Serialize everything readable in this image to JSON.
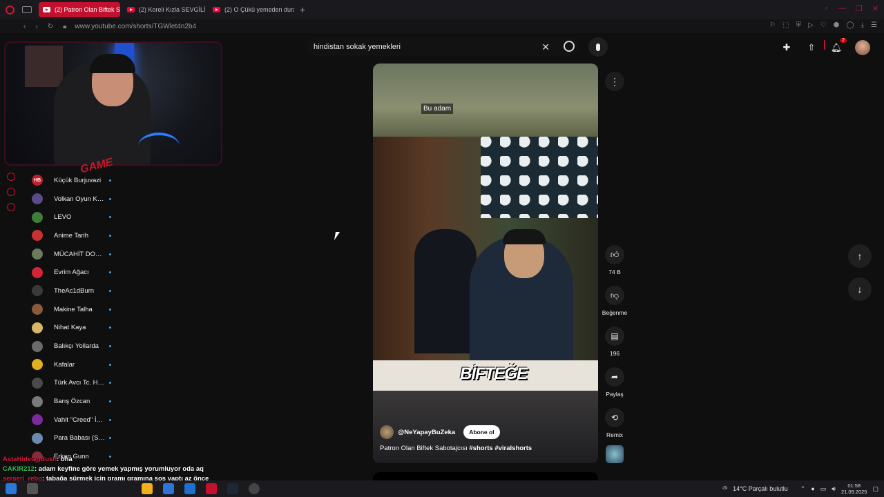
{
  "browser": {
    "tabs": [
      {
        "label": "(2) Patron Olan Biftek Sab",
        "active": true
      },
      {
        "label": "(2) Koreli Kızla SEVGİLİ O",
        "active": false
      },
      {
        "label": "(2) O Çükü yemeden dura",
        "active": false
      }
    ],
    "url": "www.youtube.com/shorts/TGWlet4n2b4",
    "accent": "#c4102f"
  },
  "search": {
    "query": "hindistan sokak yemekleri"
  },
  "header": {
    "notification_count": "2"
  },
  "subscriptions": [
    {
      "name": "Küçük Burjuvazi",
      "initials": "HB",
      "color": "#c01e2e"
    },
    {
      "name": "Volkan Oyun Kuv...",
      "initials": "",
      "color": "#5a4a8a"
    },
    {
      "name": "LEVO",
      "initials": "",
      "color": "#3f7d3a"
    },
    {
      "name": "Anime Tarih",
      "initials": "",
      "color": "#c83232"
    },
    {
      "name": "MÜCAHİT DORAY",
      "initials": "",
      "color": "#6a7a5a"
    },
    {
      "name": "Evrim Ağacı",
      "initials": "",
      "color": "#d4243a"
    },
    {
      "name": "TheAc1dBurn",
      "initials": "",
      "color": "#3a3a3a"
    },
    {
      "name": "Makine Talha",
      "initials": "",
      "color": "#8a5a3a"
    },
    {
      "name": "Nihat Kaya",
      "initials": "",
      "color": "#d9b56a"
    },
    {
      "name": "Balıkçı Yollarda",
      "initials": "",
      "color": "#6a6a6a"
    },
    {
      "name": "Kafalar",
      "initials": "",
      "color": "#e0b020"
    },
    {
      "name": "Türk Avcı Tc. Ha...",
      "initials": "",
      "color": "#4a4a4a"
    },
    {
      "name": "Barış Özcan",
      "initials": "",
      "color": "#7a7a7a"
    },
    {
      "name": "Vahit \"Creed\" İpe...",
      "initials": "",
      "color": "#7a2a9a"
    },
    {
      "name": "Para Babası (Sai...",
      "initials": "",
      "color": "#6a8ab0"
    },
    {
      "name": "Erkan Gunn",
      "initials": "",
      "color": "#8a2a3a"
    }
  ],
  "short": {
    "caption": "Bu adam",
    "overlay_text": "BİFTEĞE",
    "channel": "@NeYapayBuZeka",
    "subscribe_label": "Abone ol",
    "title_plain": "Patron Olan Biftek Sabotajcısı ",
    "title_tags": "#shorts #viralshorts"
  },
  "actions": {
    "like_count": "74 B",
    "dislike_label": "Beğenme",
    "comment_count": "196",
    "share_label": "Paylaş",
    "remix_label": "Remix"
  },
  "overlay": {
    "game_logo": "GAME"
  },
  "chat": [
    {
      "user": "AstaHideOnBush",
      "text": ": oha"
    },
    {
      "user": "CAKIR212",
      "text": ": adam keyfine göre yemek yapmış yorumluyor oda aq"
    },
    {
      "user": "serseri_rebo",
      "text": ": tabağa sürmek için gramı gramına sos yaptı az önce"
    }
  ],
  "taskbar": {
    "weather": "14°C  Parçalı bulutlu",
    "time": "01:58",
    "date": "21.09.2025"
  }
}
